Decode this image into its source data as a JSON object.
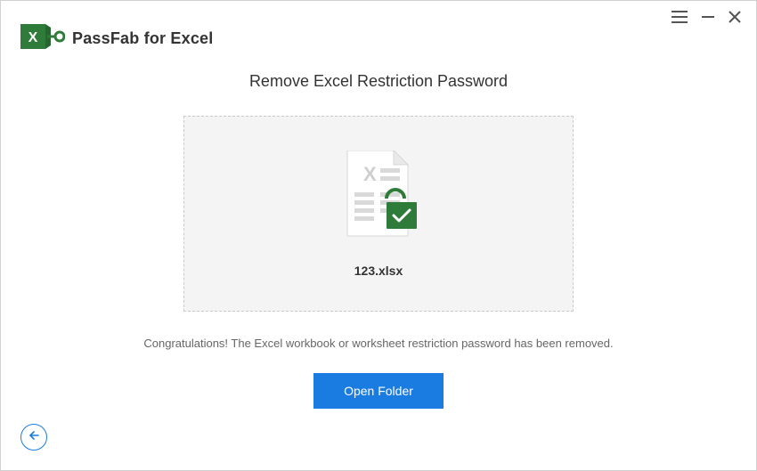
{
  "brand": {
    "name": "PassFab for Excel"
  },
  "page": {
    "title": "Remove Excel Restriction Password",
    "filename": "123.xlsx",
    "status_message": "Congratulations! The Excel workbook or worksheet restriction password has been removed.",
    "open_folder_label": "Open Folder"
  },
  "colors": {
    "accent_green": "#2f7b3a",
    "primary_blue": "#1a7be0"
  }
}
